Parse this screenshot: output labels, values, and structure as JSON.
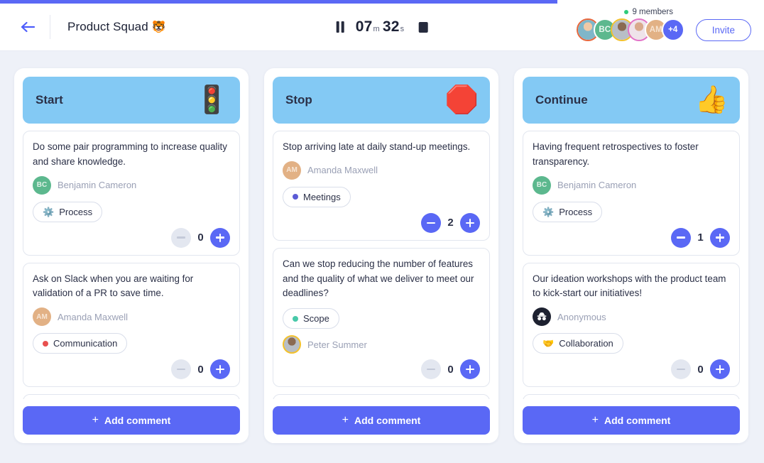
{
  "header": {
    "back_icon": "arrow-left-icon",
    "board_title": "Product Squad",
    "board_emoji": "🐯",
    "timer": {
      "pause_icon": "pause-icon",
      "minutes": "07",
      "minutes_unit": "m",
      "seconds": "32",
      "seconds_unit": "s",
      "stop_icon": "stop-icon"
    },
    "members_label": "9 members",
    "avatars": [
      {
        "type": "photo",
        "ring": "orange",
        "label": ""
      },
      {
        "type": "initials",
        "color": "green",
        "label": "BC"
      },
      {
        "type": "photo",
        "ring": "yellow",
        "label": ""
      },
      {
        "type": "photo",
        "ring": "pink",
        "label": ""
      },
      {
        "type": "initials",
        "color": "tan",
        "label": "AM"
      },
      {
        "type": "more",
        "label": "+4"
      }
    ],
    "invite_label": "Invite",
    "progress_percent": 73
  },
  "colors": {
    "accent": "#5a68f5",
    "column_header": "#83c9f4",
    "page_bg": "#eef1f8",
    "tag_meetings": "#5b5bd6",
    "tag_scope": "#48c9a9",
    "tag_communication": "#e8504f"
  },
  "add_comment_label": "Add comment",
  "add_comment_plus": "+",
  "columns": [
    {
      "title": "Start",
      "emoji": "🚦",
      "cards": [
        {
          "text": "Do some pair programming to increase quality and share knowledge.",
          "author": "Benjamin Cameron",
          "author_initials": "BC",
          "author_avatar": "initials-green",
          "tag": "Process",
          "tag_icon": "⚙️",
          "tag_dot": "",
          "votes": 0,
          "order": "author-first"
        },
        {
          "text": "Ask on Slack when you are waiting for validation of a PR to save time.",
          "author": "Amanda Maxwell",
          "author_initials": "AM",
          "author_avatar": "initials-tan",
          "tag": "Communication",
          "tag_icon": "",
          "tag_dot": "#e8504f",
          "votes": 0,
          "order": "author-first"
        }
      ]
    },
    {
      "title": "Stop",
      "emoji": "🛑",
      "cards": [
        {
          "text": "Stop arriving late at daily stand-up meetings.",
          "author": "Amanda Maxwell",
          "author_initials": "AM",
          "author_avatar": "initials-tan",
          "tag": "Meetings",
          "tag_icon": "",
          "tag_dot": "#5b5bd6",
          "votes": 2,
          "order": "author-first"
        },
        {
          "text": "Can we stop reducing the number of features and the quality of what we deliver to meet our deadlines?",
          "author": "Peter Summer",
          "author_initials": "",
          "author_avatar": "photo",
          "tag": "Scope",
          "tag_icon": "",
          "tag_dot": "#48c9a9",
          "votes": 0,
          "order": "tag-first"
        }
      ]
    },
    {
      "title": "Continue",
      "emoji": "👍",
      "cards": [
        {
          "text": "Having frequent retrospectives to foster transparency.",
          "author": "Benjamin Cameron",
          "author_initials": "BC",
          "author_avatar": "initials-green",
          "tag": "Process",
          "tag_icon": "⚙️",
          "tag_dot": "",
          "votes": 1,
          "order": "author-first"
        },
        {
          "text": "Our ideation workshops with the product team to kick-start our initiatives!",
          "author": "Anonymous",
          "author_initials": "",
          "author_avatar": "anon",
          "tag": "Collaboration",
          "tag_icon": "🤝",
          "tag_dot": "",
          "votes": 0,
          "order": "author-first"
        }
      ]
    }
  ]
}
